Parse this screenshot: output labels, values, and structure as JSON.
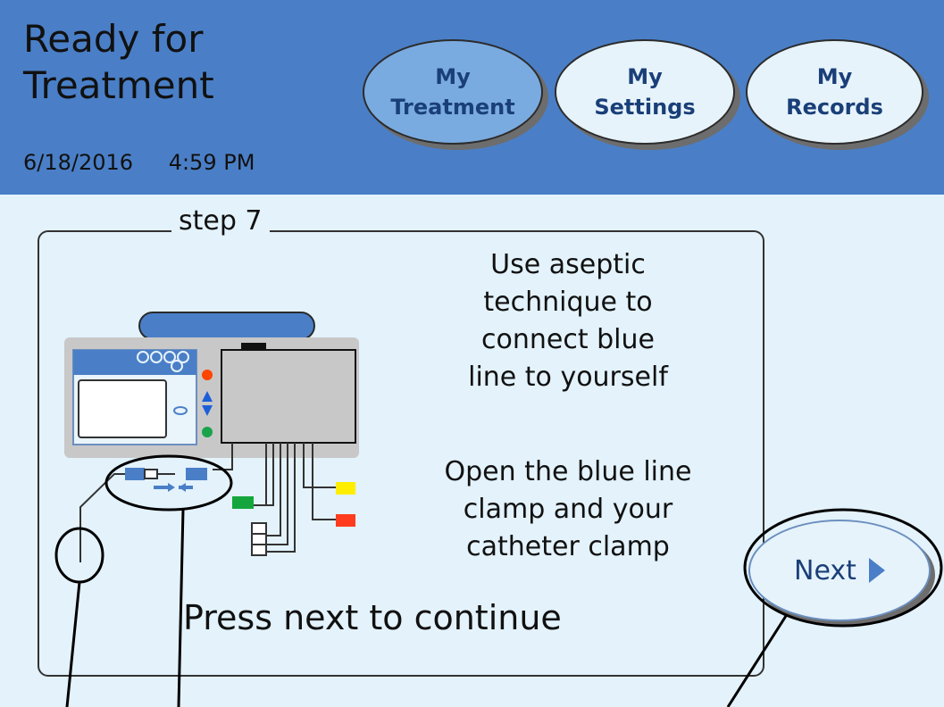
{
  "header": {
    "title_line1": "Ready for",
    "title_line2": "Treatment",
    "date": "6/18/2016",
    "time": "4:59 PM"
  },
  "nav": {
    "treatment": {
      "line1": "My",
      "line2": "Treatment"
    },
    "settings": {
      "line1": "My",
      "line2": "Settings"
    },
    "records": {
      "line1": "My",
      "line2": "Records"
    }
  },
  "step": {
    "label": "step 7",
    "instruction1": [
      "Use aseptic",
      "technique to",
      "connect blue",
      "line to yourself"
    ],
    "instruction2": [
      "Open the blue line",
      "clamp and your",
      "catheter clamp"
    ],
    "continue_text": "Press next to continue"
  },
  "next_label": "Next",
  "colors": {
    "header": "#4a7fc7",
    "background": "#e3f2fb",
    "accent": "#4a7fc7"
  }
}
